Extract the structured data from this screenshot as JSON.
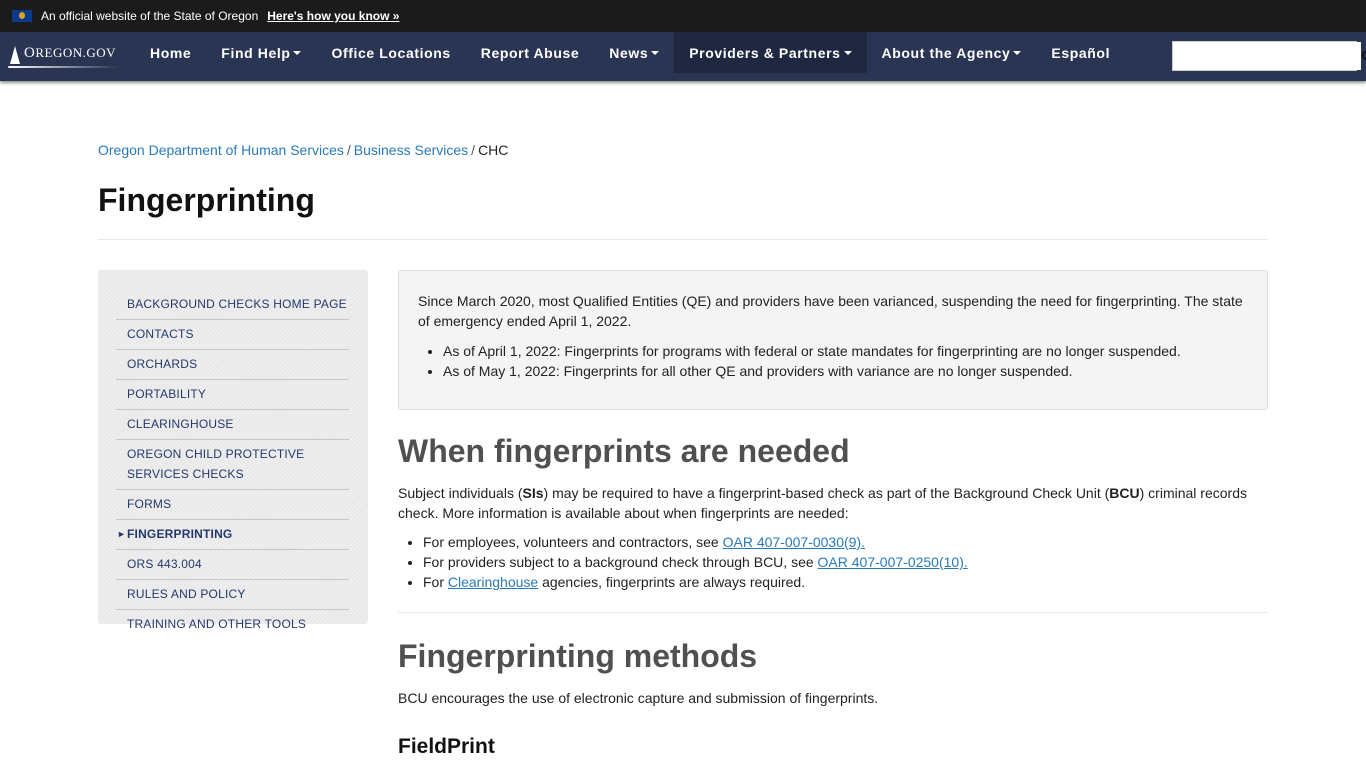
{
  "official_banner": {
    "text": "An official website of the State of Oregon",
    "link": "Here's how you know »",
    "flag_icon": "oregon-flag-icon"
  },
  "nav": {
    "logo": {
      "first": "O",
      "rest": "REGON.GOV"
    },
    "items": [
      {
        "label": "Home",
        "dropdown": false
      },
      {
        "label": "Find Help",
        "dropdown": true
      },
      {
        "label": "Office Locations",
        "dropdown": false
      },
      {
        "label": "Report Abuse",
        "dropdown": false
      },
      {
        "label": "News",
        "dropdown": true
      },
      {
        "label": "Providers & Partners",
        "dropdown": true,
        "active": true
      },
      {
        "label": "About the Agency",
        "dropdown": true
      },
      {
        "label": "Español",
        "dropdown": false
      }
    ],
    "search": {
      "value": "",
      "placeholder": "",
      "icon": "search-icon"
    }
  },
  "breadcrumb": {
    "items": [
      "Oregon Department of Human Services",
      "Business Services"
    ],
    "current": "CHC",
    "separator": "/"
  },
  "page_title": "Fingerprinting",
  "sidebar": {
    "items": [
      "BACKGROUND CHECKS HOME PAGE",
      "CONTACTS",
      "ORCHARDS",
      "PORTABILITY",
      "CLEARINGHOUSE",
      "OREGON CHILD PROTECTIVE SERVICES CHECKS",
      "FORMS",
      "FINGERPRINTING",
      "ORS 443.004",
      "RULES AND POLICY",
      "TRAINING AND OTHER TOOLS"
    ],
    "current_index": 7,
    "current_marker": "►"
  },
  "notice": {
    "text": "Since March 2020, most Qualified Entities (QE) and providers have been varianced, suspending the need for fingerprinting. The state of emergency ended April 1, 2022.",
    "bullets": [
      "As of April 1, 2022: Fingerprints for programs with federal or state mandates for fingerprinting are no longer suspended.",
      "As of May 1, 2022: Fingerprints for all other QE and providers with variance are no longer suspended."
    ]
  },
  "section1": {
    "heading": "When fingerprints are needed",
    "para": {
      "t1": "Subject individuals (",
      "b1": "SIs",
      "t2": ") may be required to have a fingerprint-based check as part of the Background Check Unit (",
      "b2": "BCU",
      "t3": ") criminal records check. More information is available about when fingerprints are needed:"
    },
    "bullets": [
      {
        "pre": "For employees, volunteers and contractors, see ",
        "link": "OAR 407-007-0030(9).",
        "post": ""
      },
      {
        "pre": "For providers subject to a background check through BCU, see ",
        "link": "OAR 407-007-0250(10).",
        "post": ""
      },
      {
        "pre": "For ",
        "link": "Clearinghouse",
        "post": " agencies, fingerprints are always required."
      }
    ]
  },
  "section2": {
    "heading": "Fingerprinting methods",
    "para": "BCU encourages the use of electronic capture and submission of fingerprints.",
    "subheading": "FieldPrint"
  },
  "colors": {
    "nav_bg": "#2a3554",
    "banner_bg": "#1b1b1b",
    "link": "#2a7ab8",
    "sidebar_text": "#24396b",
    "heading_gray": "#505050"
  }
}
